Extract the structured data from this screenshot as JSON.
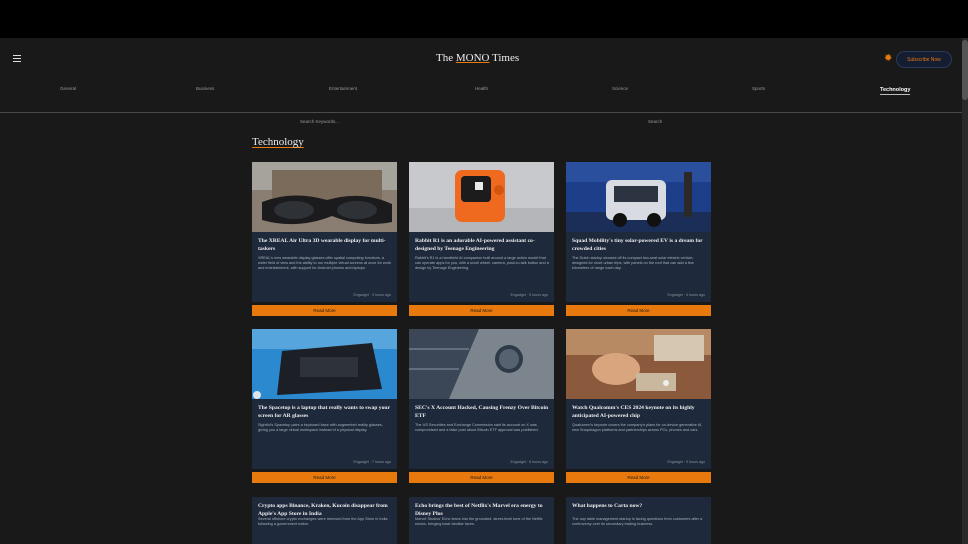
{
  "header": {
    "logo_pre": "The ",
    "logo_hl": "MONO",
    "logo_post": " Times",
    "subscribe_label": "Subscribe Now"
  },
  "nav": [
    "General",
    "Business",
    "Entertainment",
    "Health",
    "Science",
    "Sports",
    "Technology"
  ],
  "nav_active": "Technology",
  "search": {
    "placeholder": "Search Keywords...",
    "button": "Search"
  },
  "page_title": "Technology",
  "read_more": "Read More",
  "cards": [
    {
      "title": "The XREAL Air Ultra 3D wearable display for multi-taskers",
      "excerpt": "XREAL's new wearable display glasses offer spatial computing functions, a wider field of view and the ability to run multiple virtual screens at once for work and entertainment, with support for Android phones and laptops.",
      "meta": "Engadget · 3 hours ago"
    },
    {
      "title": "Rabbit R1 is an adorable AI-powered assistant co-designed by Teenage Engineering",
      "excerpt": "Rabbit's R1 is a handheld AI companion built around a large action model that can operate apps for you, with a scroll wheel, camera, push-to-talk button and a design by Teenage Engineering.",
      "meta": "Engadget · 5 hours ago"
    },
    {
      "title": "Squad Mobility's tiny solar-powered EV is a dream for crowded cities",
      "excerpt": "The Dutch startup showed off its compact two-seat solar electric vehicle, designed for short urban trips, with panels on the roof that can add a few kilometers of range each day.",
      "meta": "Engadget · 6 hours ago"
    },
    {
      "title": "The Spacetop is a laptop that really wants to swap your screen for AR glasses",
      "excerpt": "Sightful's Spacetop pairs a keyboard base with augmented reality glasses, giving you a large virtual workspace instead of a physical display.",
      "meta": "Engadget · 7 hours ago"
    },
    {
      "title": "SEC's X Account Hacked, Causing Frenzy Over Bitcoin ETF",
      "excerpt": "The US Securities and Exchange Commission said its account on X was compromised and a false post about Bitcoin ETF approval was published.",
      "meta": "Engadget · 8 hours ago"
    },
    {
      "title": "Watch Qualcomm's CES 2024 keynote on its highly anticipated AI-powered chip",
      "excerpt": "Qualcomm's keynote covers the company's plans for on-device generative AI, new Snapdragon platforms and partnerships across PCs, phones and cars.",
      "meta": "Engadget · 9 hours ago"
    },
    {
      "title": "Crypto apps Binance, Kraken, Kucoin disappear from Apple's App Store in India",
      "excerpt": "Several offshore crypto exchanges were removed from the App Store in India following a government notice.",
      "meta": ""
    },
    {
      "title": "Echo brings the best of Netflix's Marvel era energy to Disney Plus",
      "excerpt": "Marvel Studios' Echo leans into the grounded, street-level tone of the Netflix shows, bringing back familiar faces.",
      "meta": ""
    },
    {
      "title": "What happens to Carta now?",
      "excerpt": "The cap table management startup is facing questions from customers after a controversy over its secondary trading business.",
      "meta": ""
    }
  ]
}
